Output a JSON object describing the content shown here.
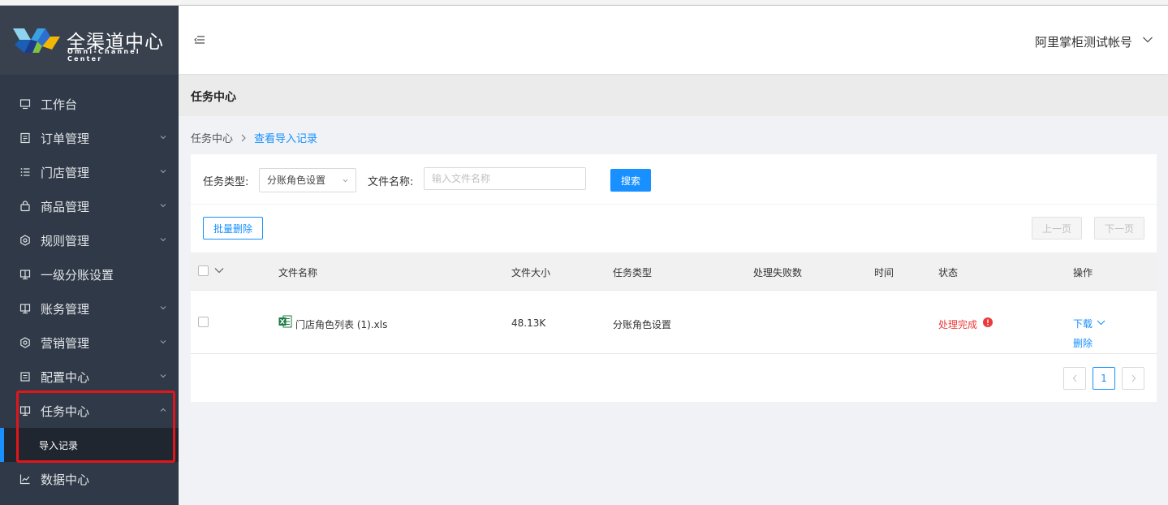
{
  "brand": {
    "title": "全渠道中心",
    "subtitle": "Omni-Channel Center"
  },
  "sidebar": {
    "items": [
      {
        "label": "工作台",
        "icon": "monitor-icon",
        "has_children": false
      },
      {
        "label": "订单管理",
        "icon": "document-icon",
        "has_children": true
      },
      {
        "label": "门店管理",
        "icon": "list-icon",
        "has_children": true
      },
      {
        "label": "商品管理",
        "icon": "bag-icon",
        "has_children": true
      },
      {
        "label": "规则管理",
        "icon": "settings-icon",
        "has_children": true
      },
      {
        "label": "一级分账设置",
        "icon": "split-icon",
        "has_children": false
      },
      {
        "label": "账务管理",
        "icon": "split-icon",
        "has_children": true
      },
      {
        "label": "营销管理",
        "icon": "settings-icon",
        "has_children": true
      },
      {
        "label": "配置中心",
        "icon": "config-icon",
        "has_children": true
      },
      {
        "label": "任务中心",
        "icon": "task-icon",
        "has_children": true,
        "expanded": true
      },
      {
        "label": "数据中心",
        "icon": "chart-icon",
        "has_children": false
      }
    ],
    "sub_items": [
      {
        "label": "导入记录",
        "active": true
      }
    ]
  },
  "header": {
    "user_name": "阿里掌柜测试帐号"
  },
  "page": {
    "title": "任务中心",
    "breadcrumb": {
      "home": "任务中心",
      "current": "查看导入记录"
    }
  },
  "filter": {
    "task_type_label": "任务类型:",
    "task_type_value": "分账角色设置",
    "file_name_label": "文件名称:",
    "file_name_placeholder": "输入文件名称",
    "file_name_value": "",
    "search_label": "搜索"
  },
  "toolbar": {
    "batch_delete_label": "批量删除",
    "prev_page_label": "上一页",
    "next_page_label": "下一页"
  },
  "table": {
    "columns": [
      "文件名称",
      "文件大小",
      "任务类型",
      "处理失败数",
      "时间",
      "状态",
      "操作"
    ],
    "rows": [
      {
        "file_name": "门店角色列表 (1).xls",
        "file_size": "48.13K",
        "task_type": "分账角色设置",
        "failed_count": "",
        "time": "",
        "status": "处理完成",
        "actions": {
          "download": "下载",
          "delete": "删除"
        }
      }
    ]
  },
  "pagination": {
    "current_page": "1"
  },
  "colors": {
    "primary": "#1890ff",
    "sidebar_bg": "#2f3947",
    "status_done": "#ec3a3a",
    "highlight_border": "#e2151b"
  }
}
